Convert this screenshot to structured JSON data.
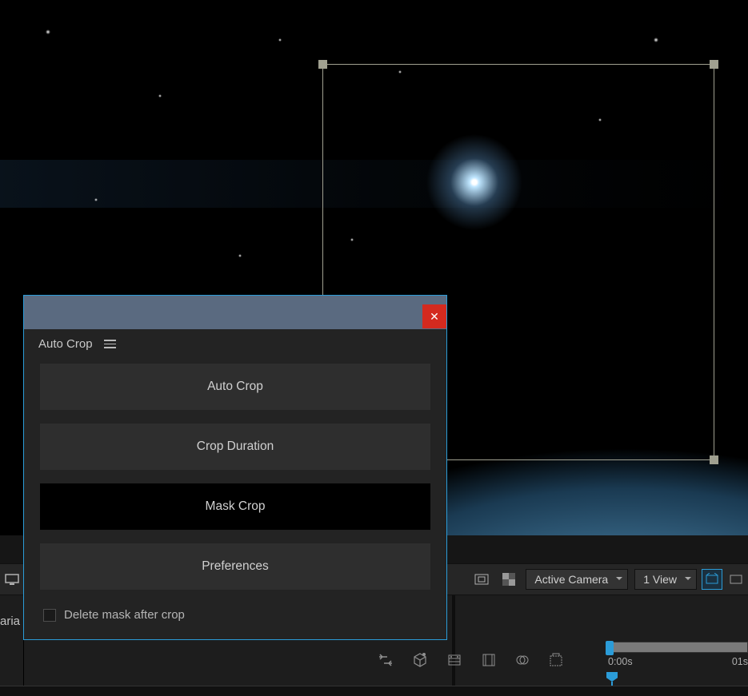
{
  "panel": {
    "title": "Auto Crop",
    "buttons": {
      "auto_crop": "Auto Crop",
      "crop_duration": "Crop Duration",
      "mask_crop": "Mask Crop",
      "preferences": "Preferences"
    },
    "checkbox_label": "Delete mask after crop",
    "close_glyph": "✕"
  },
  "viewer_bar": {
    "camera_dropdown": "Active Camera",
    "view_dropdown": "1 View"
  },
  "lower": {
    "aria_fragment": "aria",
    "time_start": "0:00s",
    "time_next": "01s"
  }
}
